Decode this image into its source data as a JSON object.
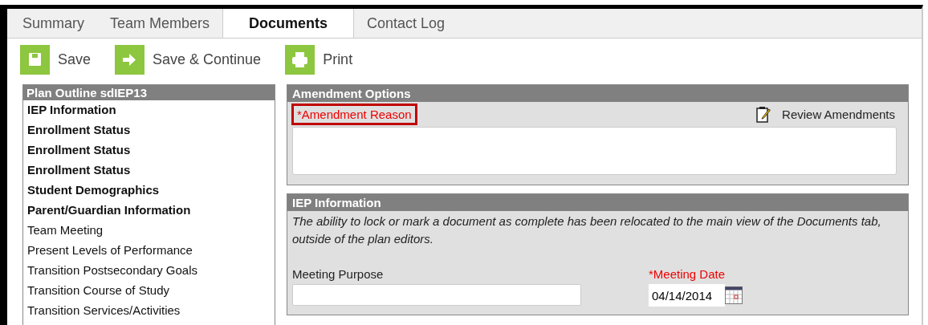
{
  "tabs": [
    {
      "label": "Summary",
      "selected": false
    },
    {
      "label": "Team Members",
      "selected": false
    },
    {
      "label": "Documents",
      "selected": true
    },
    {
      "label": "Contact Log",
      "selected": false
    }
  ],
  "toolbar": [
    {
      "label": "Save",
      "kind": "save"
    },
    {
      "label": "Save & Continue",
      "kind": "continue"
    },
    {
      "label": "Print",
      "kind": "print"
    }
  ],
  "outline": {
    "title": "Plan Outline sdIEP13",
    "items": [
      {
        "label": "IEP Information",
        "bold": true
      },
      {
        "label": "Enrollment Status",
        "bold": true
      },
      {
        "label": "Enrollment Status",
        "bold": true
      },
      {
        "label": "Enrollment Status",
        "bold": true
      },
      {
        "label": "Student Demographics",
        "bold": true
      },
      {
        "label": "Parent/Guardian Information",
        "bold": true
      },
      {
        "label": "Team Meeting",
        "bold": false
      },
      {
        "label": "Present Levels of Performance",
        "bold": false
      },
      {
        "label": "Transition Postsecondary Goals",
        "bold": false
      },
      {
        "label": "Transition Course of Study",
        "bold": false
      },
      {
        "label": "Transition Services/Activities",
        "bold": false
      }
    ]
  },
  "amendment": {
    "title": "Amendment Options",
    "reason_label": "*Amendment Reason",
    "required": true,
    "highlighted": true,
    "review_link": "Review Amendments"
  },
  "iep": {
    "title": "IEP Information",
    "note": "The ability to lock or mark a document as complete has been relocated to the main view of the Documents tab, outside of the plan editors.",
    "fields": [
      {
        "label": "Meeting Purpose",
        "required": false,
        "kind": "text"
      },
      {
        "label": "*Meeting Date",
        "required": true,
        "kind": "date",
        "value": "04/14/2014"
      }
    ]
  }
}
